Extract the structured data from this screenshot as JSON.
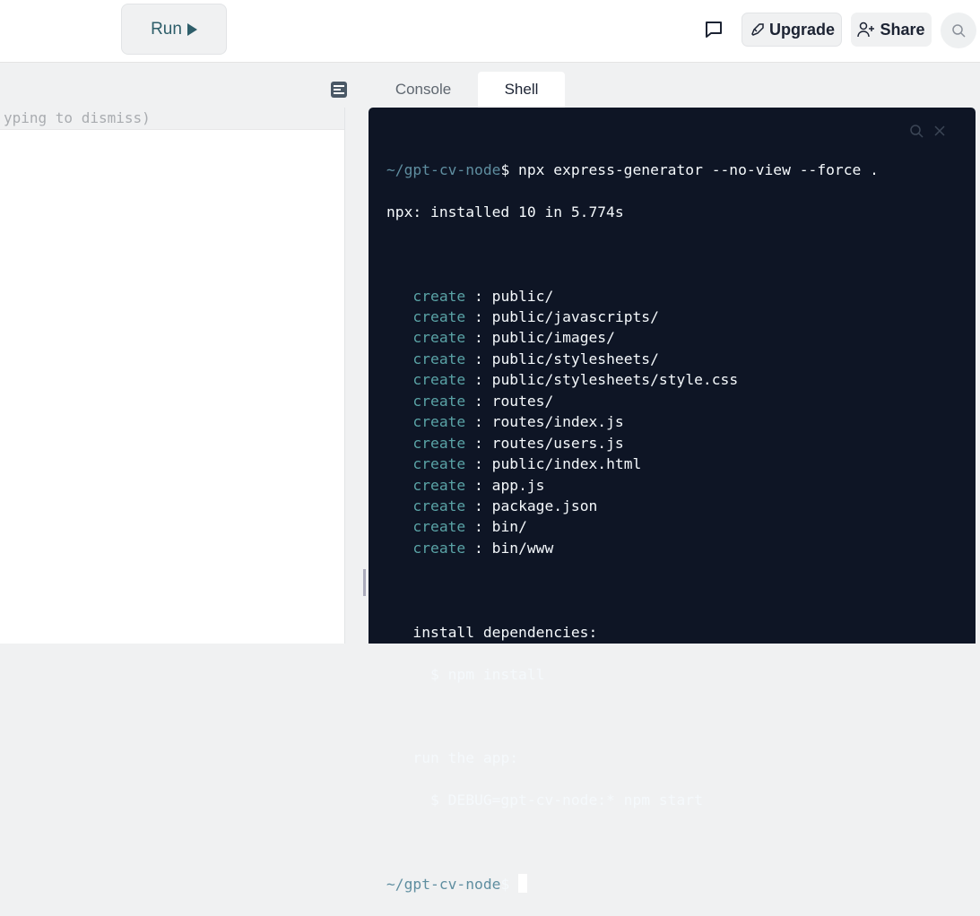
{
  "toolbar": {
    "run_label": "Run",
    "upgrade_label": "Upgrade",
    "share_label": "Share"
  },
  "editor": {
    "hint": "yping to dismiss)"
  },
  "tabs": [
    {
      "label": "Console"
    },
    {
      "label": "Shell",
      "active": true
    }
  ],
  "terminal": {
    "prompt": "~/gpt-cv-node",
    "command": "$ npx express-generator --no-view --force .",
    "installed": "npx: installed 10 in 5.774s",
    "create_keyword": "create",
    "created": [
      "public/",
      "public/javascripts/",
      "public/images/",
      "public/stylesheets/",
      "public/stylesheets/style.css",
      "routes/",
      "routes/index.js",
      "routes/users.js",
      "public/index.html",
      "app.js",
      "package.json",
      "bin/",
      "bin/www"
    ],
    "install_heading": "install dependencies:",
    "install_cmd": "$ npm install",
    "run_heading": "run the app:",
    "run_cmd": "$ DEBUG=gpt-cv-node:* npm start",
    "final_prompt_suffix": "$ "
  }
}
